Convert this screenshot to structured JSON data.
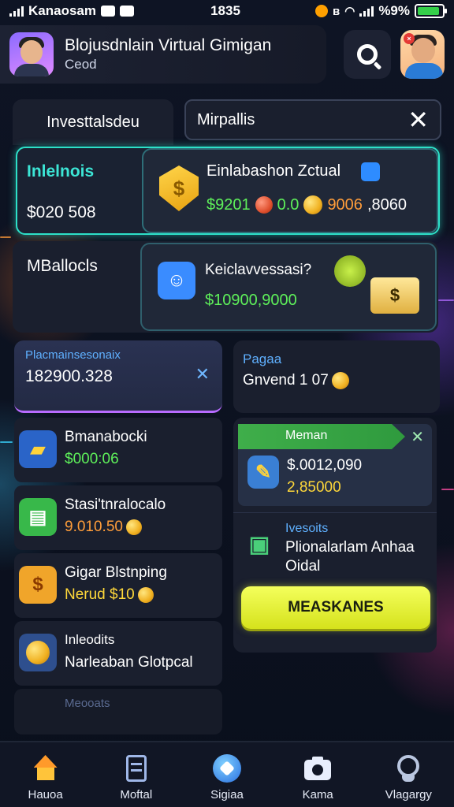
{
  "status_bar": {
    "carrier": "Kanaosam",
    "time": "1835",
    "battery": "%9%"
  },
  "header": {
    "title": "Blojusdnlain Virtual Gimigan",
    "subtitle": "Ceod"
  },
  "tabs": {
    "active_label": "Investtalsdeu"
  },
  "filter": {
    "label": "Mirpallis"
  },
  "card_featured": {
    "label": "Inlelnois",
    "amount": "$020 508",
    "title": "Einlabashon Zctual",
    "value1": "$9201",
    "value2": "0.0",
    "value3": "9006",
    "value4": ",8060"
  },
  "card_second": {
    "label": "MBallocls",
    "title": "Keiclavvessasi?",
    "value": "$10900,9000"
  },
  "balance_card": {
    "label": "Placmainsesonaix",
    "value": "182900.328"
  },
  "pagaa_card": {
    "label": "Pagaa",
    "value": "Gnvend 1 07"
  },
  "list_items": [
    {
      "title": "Bmanabocki",
      "value": "$000:06",
      "icon": "gold-bar-icon"
    },
    {
      "title": "Stasi'tnralocalo",
      "value": "9.010.50",
      "icon": "ticket-icon"
    },
    {
      "title": "Gigar Blstnping",
      "value": "Nerud $10",
      "icon": "gift-icon"
    },
    {
      "title": "Inleodits",
      "value": "Narleaban Glotpcal",
      "icon": "coin-badge-icon"
    }
  ],
  "list_footer": "Meooats",
  "right_panel": {
    "banner_label": "Meman",
    "value1": "$.0012,090",
    "value2": "2,85000",
    "note_label": "Ivesoits",
    "note_text_line1": "Plionalarlam Anhaa",
    "note_text_line2": "Oidal",
    "cta_label": "MEASKANES"
  },
  "bottom_nav": [
    {
      "label": "Hauoa",
      "icon": "home-icon"
    },
    {
      "label": "Moftal",
      "icon": "clipboard-icon"
    },
    {
      "label": "Sigiaa",
      "icon": "rocket-icon"
    },
    {
      "label": "Kama",
      "icon": "camera-icon"
    },
    {
      "label": "Vlagargy",
      "icon": "profile-icon"
    }
  ],
  "colors": {
    "accent_teal": "#2de0c8",
    "accent_green": "#5ef05a",
    "accent_yellow": "#ffd83a",
    "cta_yellow": "#e9f43a",
    "panel_bg": "#1a1f2e"
  }
}
